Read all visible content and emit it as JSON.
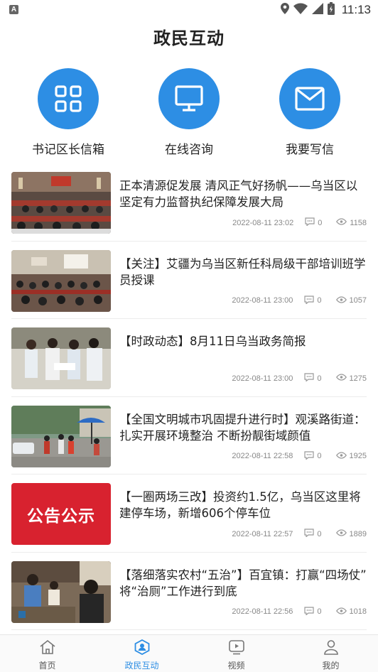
{
  "status_bar": {
    "time": "11:13",
    "app_badge": "A"
  },
  "page": {
    "title": "政民互动"
  },
  "actions": [
    {
      "label": "书记区长信箱",
      "icon": "grid-icon"
    },
    {
      "label": "在线咨询",
      "icon": "monitor-icon"
    },
    {
      "label": "我要写信",
      "icon": "mail-icon"
    }
  ],
  "news": [
    {
      "title": "正本清源促发展 清风正气好扬帆——乌当区以坚定有力监督执纪保障发展大局",
      "date": "2022-08-11 23:02",
      "comments": "0",
      "views": "1158"
    },
    {
      "title": "【关注】艾疆为乌当区新任科局级干部培训班学员授课",
      "date": "2022-08-11 23:00",
      "comments": "0",
      "views": "1057"
    },
    {
      "title": "【时政动态】8月11日乌当政务简报",
      "date": "2022-08-11 23:00",
      "comments": "0",
      "views": "1275"
    },
    {
      "title": "【全国文明城市巩固提升进行时】观溪路街道：扎实开展环境整治 不断扮靓街域颜值",
      "date": "2022-08-11 22:58",
      "comments": "0",
      "views": "1925"
    },
    {
      "title": "【一圈两场三改】投资约1.5亿，乌当区这里将建停车场，新增606个停车位",
      "date": "2022-08-11 22:57",
      "comments": "0",
      "views": "1889",
      "thumb_text": "公告公示"
    },
    {
      "title": "【落细落实农村“五治”】百宜镇：打赢“四场仗” 将“治厕”工作进行到底",
      "date": "2022-08-11 22:56",
      "comments": "0",
      "views": "1018"
    }
  ],
  "tabs": [
    {
      "label": "首页",
      "icon": "home-icon",
      "active": false
    },
    {
      "label": "政民互动",
      "icon": "interaction-icon",
      "active": true
    },
    {
      "label": "视频",
      "icon": "video-icon",
      "active": false
    },
    {
      "label": "我的",
      "icon": "profile-icon",
      "active": false
    }
  ],
  "colors": {
    "accent": "#2d8ee4",
    "text": "#222222",
    "meta": "#888888"
  }
}
